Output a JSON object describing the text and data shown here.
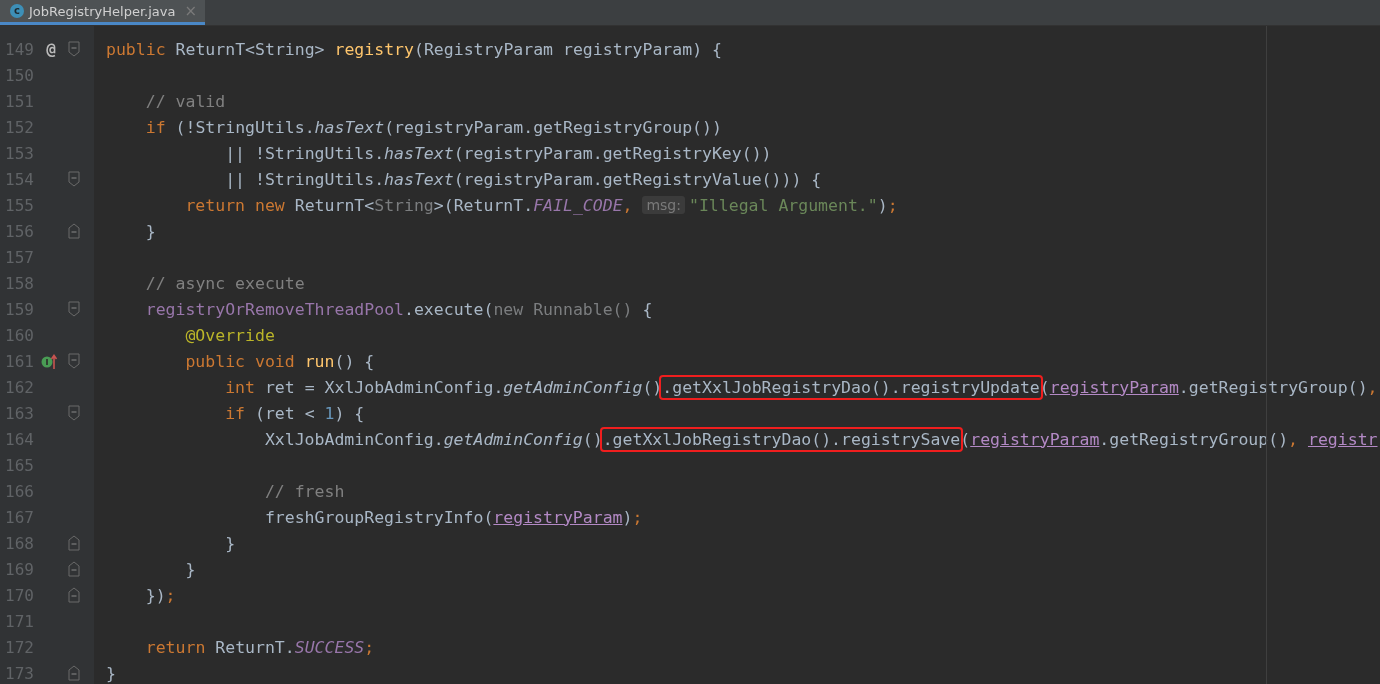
{
  "tabs": [
    {
      "label": "JobRegistryHelper.java",
      "icon_letter": "c",
      "close": "×",
      "selected": true
    }
  ],
  "lines": [
    {
      "number": "149",
      "gutter": {
        "kind": "symbol",
        "text": "@"
      },
      "fold_marker": {
        "kind": "start"
      },
      "tokens": [
        {
          "kind": "kw",
          "text": "public "
        },
        {
          "kind": "plain",
          "text": "ReturnT<String> "
        },
        {
          "kind": "decl",
          "text": "registry"
        },
        {
          "kind": "plain",
          "text": "(RegistryParam registryParam) {"
        }
      ],
      "children": [
        {
          "number": "150"
        },
        {
          "number": "151",
          "tokens": [
            {
              "kind": "comment",
              "text": "// valid"
            }
          ]
        },
        {
          "number": "152",
          "tokens": [
            {
              "kind": "kw",
              "text": "if "
            },
            {
              "kind": "plain",
              "text": "(!StringUtils."
            },
            {
              "kind": "italic",
              "text": "hasText"
            },
            {
              "kind": "plain",
              "text": "(registryParam.getRegistryGroup())"
            }
          ],
          "children": [
            {
              "number": "153",
              "kind": "continuation",
              "tokens": [
                {
                  "kind": "plain",
                  "text": "|| !StringUtils."
                },
                {
                  "kind": "italic",
                  "text": "hasText"
                },
                {
                  "kind": "plain",
                  "text": "(registryParam.getRegistryKey())"
                }
              ]
            },
            {
              "number": "154",
              "kind": "continuation",
              "fold_marker": {
                "kind": "start"
              },
              "tokens": [
                {
                  "kind": "plain",
                  "text": "|| !StringUtils."
                },
                {
                  "kind": "italic",
                  "text": "hasText"
                },
                {
                  "kind": "plain",
                  "text": "(registryParam.getRegistryValue())) {"
                }
              ]
            },
            {
              "number": "155",
              "tokens": [
                {
                  "kind": "kw",
                  "text": "return new "
                },
                {
                  "kind": "plain",
                  "text": "ReturnT<"
                },
                {
                  "kind": "grey",
                  "text": "String"
                },
                {
                  "kind": "plain",
                  "text": ">(ReturnT."
                },
                {
                  "kind": "static",
                  "text": "FAIL_CODE"
                },
                {
                  "kind": "kw",
                  "text": ", "
                },
                {
                  "kind": "hint",
                  "text": "msg:"
                },
                {
                  "kind": "string",
                  "text": "\"Illegal Argument.\""
                },
                {
                  "kind": "plain",
                  "text": ")"
                },
                {
                  "kind": "kw",
                  "text": ";"
                }
              ]
            }
          ]
        },
        {
          "number": "156",
          "fold_marker": {
            "kind": "end"
          },
          "tokens": [
            {
              "kind": "plain",
              "text": "}"
            }
          ]
        },
        {
          "number": "157"
        },
        {
          "number": "158",
          "tokens": [
            {
              "kind": "comment",
              "text": "// async execute"
            }
          ]
        },
        {
          "number": "159",
          "fold_marker": {
            "kind": "start"
          },
          "tokens": [
            {
              "kind": "field",
              "text": "registryOrRemoveThreadPool"
            },
            {
              "kind": "plain",
              "text": ".execute("
            },
            {
              "kind": "grey",
              "text": "new Runnable() "
            },
            {
              "kind": "plain",
              "text": "{"
            }
          ],
          "children": [
            {
              "number": "160",
              "tokens": [
                {
                  "kind": "anno",
                  "text": "@Override"
                }
              ]
            },
            {
              "number": "161",
              "gutter": {
                "kind": "override"
              },
              "fold_marker": {
                "kind": "start"
              },
              "tokens": [
                {
                  "kind": "kw",
                  "text": "public void "
                },
                {
                  "kind": "decl",
                  "text": "run"
                },
                {
                  "kind": "plain",
                  "text": "() {"
                }
              ],
              "children": [
                {
                  "number": "162",
                  "tokens": [
                    {
                      "kind": "kw",
                      "text": "int "
                    },
                    {
                      "kind": "plain",
                      "text": "ret = XxlJobAdminConfig."
                    },
                    {
                      "kind": "italic",
                      "text": "getAdminConfig"
                    },
                    {
                      "kind": "plain",
                      "text": "()"
                    },
                    {
                      "kind": "plain",
                      "text": ".getXxlJobRegistryDao().registryUpdate",
                      "highlighted": true
                    },
                    {
                      "kind": "plain",
                      "text": "("
                    },
                    {
                      "kind": "captured",
                      "text": "registryParam"
                    },
                    {
                      "kind": "plain",
                      "text": ".getRegistryGroup()"
                    },
                    {
                      "kind": "kw",
                      "text": ","
                    }
                  ]
                },
                {
                  "number": "163",
                  "fold_marker": {
                    "kind": "start"
                  },
                  "tokens": [
                    {
                      "kind": "kw",
                      "text": "if "
                    },
                    {
                      "kind": "plain",
                      "text": "(ret < "
                    },
                    {
                      "kind": "num",
                      "text": "1"
                    },
                    {
                      "kind": "plain",
                      "text": ") {"
                    }
                  ],
                  "children": [
                    {
                      "number": "164",
                      "tokens": [
                        {
                          "kind": "plain",
                          "text": "XxlJobAdminConfig."
                        },
                        {
                          "kind": "italic",
                          "text": "getAdminConfig"
                        },
                        {
                          "kind": "plain",
                          "text": "()"
                        },
                        {
                          "kind": "plain",
                          "text": ".getXxlJobRegistryDao().registrySave",
                          "highlighted": true
                        },
                        {
                          "kind": "plain",
                          "text": "("
                        },
                        {
                          "kind": "captured",
                          "text": "registryParam"
                        },
                        {
                          "kind": "plain",
                          "text": ".getRegistryGroup()"
                        },
                        {
                          "kind": "kw",
                          "text": ", "
                        },
                        {
                          "kind": "captured",
                          "text": "registr"
                        }
                      ]
                    },
                    {
                      "number": "165"
                    },
                    {
                      "number": "166",
                      "tokens": [
                        {
                          "kind": "comment",
                          "text": "// fresh"
                        }
                      ]
                    },
                    {
                      "number": "167",
                      "tokens": [
                        {
                          "kind": "plain",
                          "text": "freshGroupRegistryInfo("
                        },
                        {
                          "kind": "captured",
                          "text": "registryParam"
                        },
                        {
                          "kind": "plain",
                          "text": ")"
                        },
                        {
                          "kind": "kw",
                          "text": ";"
                        }
                      ]
                    }
                  ]
                },
                {
                  "number": "168",
                  "fold_marker": {
                    "kind": "end"
                  },
                  "tokens": [
                    {
                      "kind": "plain",
                      "text": "}"
                    }
                  ]
                }
              ]
            },
            {
              "number": "169",
              "fold_marker": {
                "kind": "end"
              },
              "tokens": [
                {
                  "kind": "plain",
                  "text": "}"
                }
              ]
            }
          ]
        },
        {
          "number": "170",
          "fold_marker": {
            "kind": "end"
          },
          "tokens": [
            {
              "kind": "plain",
              "text": "})"
            },
            {
              "kind": "kw",
              "text": ";"
            }
          ]
        },
        {
          "number": "171"
        },
        {
          "number": "172",
          "tokens": [
            {
              "kind": "kw",
              "text": "return "
            },
            {
              "kind": "plain",
              "text": "ReturnT."
            },
            {
              "kind": "static",
              "text": "SUCCESS"
            },
            {
              "kind": "kw",
              "text": ";"
            }
          ]
        }
      ]
    },
    {
      "number": "173",
      "fold_marker": {
        "kind": "end"
      },
      "tokens": [
        {
          "kind": "plain",
          "text": "}"
        }
      ]
    }
  ]
}
